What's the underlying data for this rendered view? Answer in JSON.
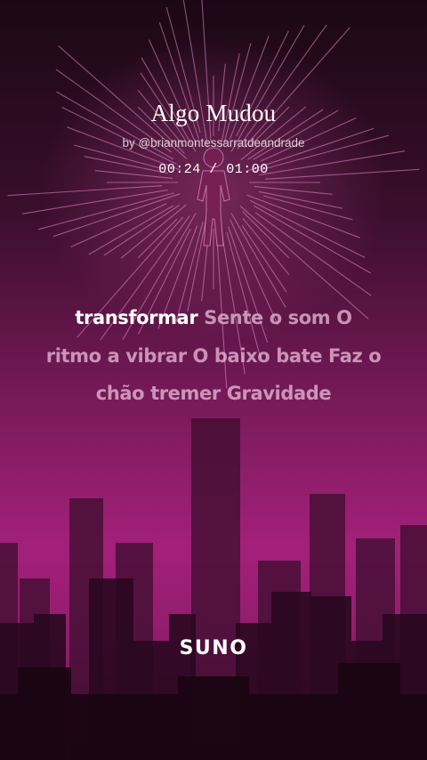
{
  "song": {
    "title": "Algo Mudou",
    "author": "by @brianmontessarratdeandrade",
    "time_display": "00:24 / 01:00"
  },
  "lyrics": {
    "active_word": "transformar",
    "upcoming_text": "Sente o som O ritmo a vibrar O baixo bate Faz o chão tremer Gravidade"
  },
  "brand": {
    "logo_text": "SUNO"
  },
  "colors": {
    "accent_magenta": "#a3207a",
    "dark_background": "#1a0713"
  }
}
